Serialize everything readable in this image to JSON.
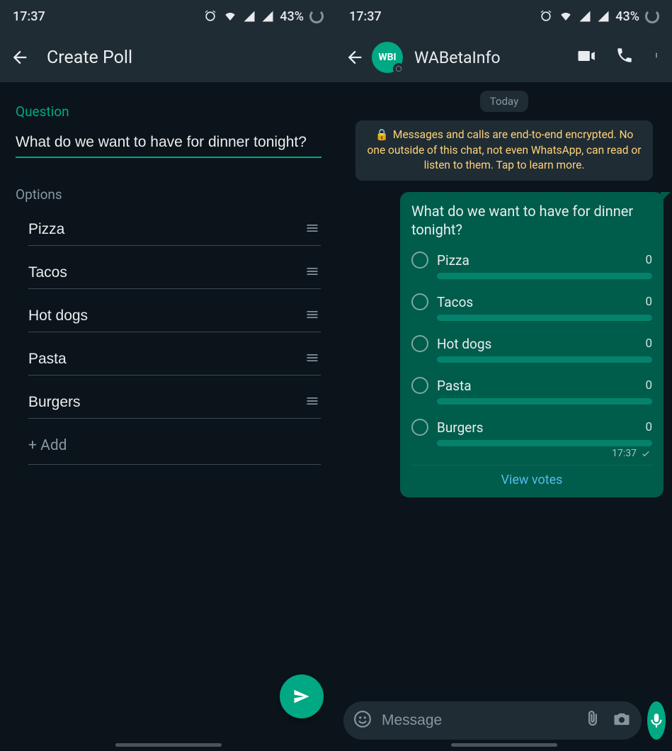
{
  "status": {
    "time": "17:37",
    "battery": "43%"
  },
  "left": {
    "title": "Create Poll",
    "question_label": "Question",
    "question_value": "What do we want to have for dinner tonight?",
    "options_label": "Options",
    "options": [
      "Pizza",
      "Tacos",
      "Hot dogs",
      "Pasta",
      "Burgers"
    ],
    "add_label": "+ Add"
  },
  "right": {
    "contact_name": "WABetaInfo",
    "avatar_text": "WBI",
    "date_chip": "Today",
    "encryption_notice": "Messages and calls are end-to-end encrypted. No one outside of this chat, not even WhatsApp, can read or listen to them. Tap to learn more.",
    "poll": {
      "question": "What do we want to have for dinner tonight?",
      "options": [
        {
          "label": "Pizza",
          "count": "0"
        },
        {
          "label": "Tacos",
          "count": "0"
        },
        {
          "label": "Hot dogs",
          "count": "0"
        },
        {
          "label": "Pasta",
          "count": "0"
        },
        {
          "label": "Burgers",
          "count": "0"
        }
      ],
      "time": "17:37",
      "view_votes": "View votes"
    },
    "input_placeholder": "Message"
  }
}
